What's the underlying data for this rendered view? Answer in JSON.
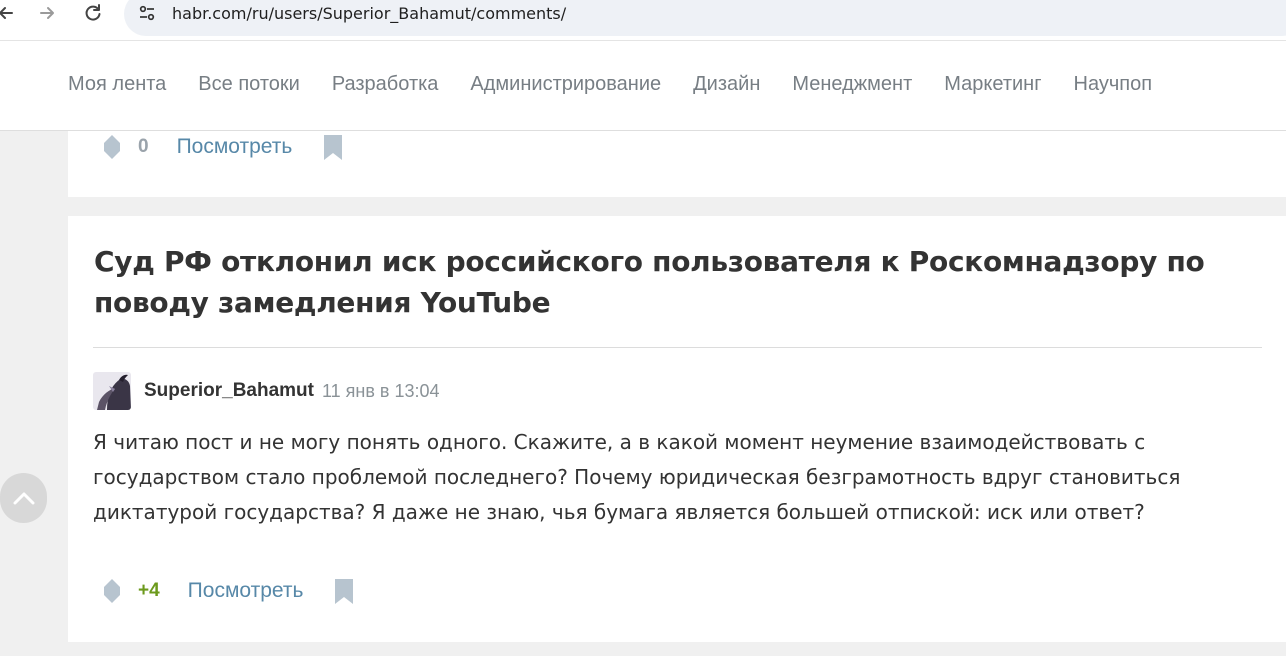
{
  "browser": {
    "url": "habr.com/ru/users/Superior_Bahamut/comments/",
    "icons": {
      "back": "arrow-left-icon",
      "forward": "arrow-right-icon",
      "reload": "reload-icon",
      "site_info": "site-settings-icon"
    }
  },
  "header": {
    "nav": [
      "Моя лента",
      "Все потоки",
      "Разработка",
      "Администрирование",
      "Дизайн",
      "Менеджмент",
      "Маркетинг",
      "Научпоп"
    ]
  },
  "previous_comment": {
    "score": "0",
    "view_label": "Посмотреть"
  },
  "post": {
    "title": "Суд РФ отклонил иск российского пользователя к Роскомнадзору по поводу замедления YouTube"
  },
  "comment": {
    "author": "Superior_Bahamut",
    "time": "11 янв в 13:04",
    "text": "Я читаю пост и не могу понять одного. Скажите, а в какой момент неумение взаимодействовать с государством стало проблемой последнего? Почему юридическая безграмотность вдруг становиться диктатурой государства? Я даже не знаю, чья бумага является большей отпиской: иск или ответ?",
    "score": "+4",
    "view_label": "Посмотреть"
  },
  "colors": {
    "page_bg": "#f0f0f0",
    "link": "#5788a8",
    "score_positive": "#6c9a1c",
    "icon_gray": "#b7c4cf"
  }
}
